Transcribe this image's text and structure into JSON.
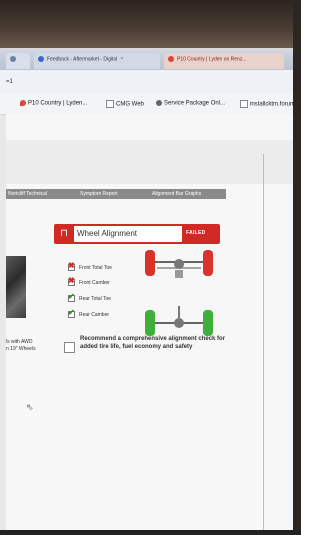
{
  "browser": {
    "tabs": [
      {
        "label": "",
        "fav_color": "#6b7fa8"
      },
      {
        "label": "Feedback - Aftermarket - Digital",
        "fav_color": "#3b67c9"
      },
      {
        "label": "P10 Country | Lyden on Renz...",
        "fav_color": "#d24b3c"
      }
    ],
    "address": "=1",
    "bookmarks": [
      {
        "label": "P10 Country | Lyden...",
        "icon_color": "#d24b3c"
      },
      {
        "label": "CMG Web",
        "icon_color": "#888888"
      },
      {
        "label": "Service Package Onl...",
        "icon_color": "#666666"
      },
      {
        "label": "installcktm.forum...",
        "icon_color": "#888888"
      }
    ]
  },
  "section_tabs": [
    "Nortcliff Technical",
    "Symptom Report",
    "Alignment Bar Graphs"
  ],
  "wheel_alignment": {
    "title": "Wheel Alignment",
    "status": "FAILED",
    "checks": [
      {
        "label": "Front Total Toe",
        "result": "fail"
      },
      {
        "label": "Front Camber",
        "result": "fail"
      },
      {
        "label": "Rear Total Toe",
        "result": "pass"
      },
      {
        "label": "Rear Camber",
        "result": "pass"
      }
    ]
  },
  "vehicle_note": [
    "ls with AWD",
    "n 19\" Wheels"
  ],
  "recommendation": "Recommend a comprehensive alignment check for added tire life, fuel economy and safety",
  "colors": {
    "fail": "#cf2a25",
    "pass": "#2e8b3a",
    "front_wheel": "#d9342c",
    "rear_wheel": "#3fae3a"
  }
}
